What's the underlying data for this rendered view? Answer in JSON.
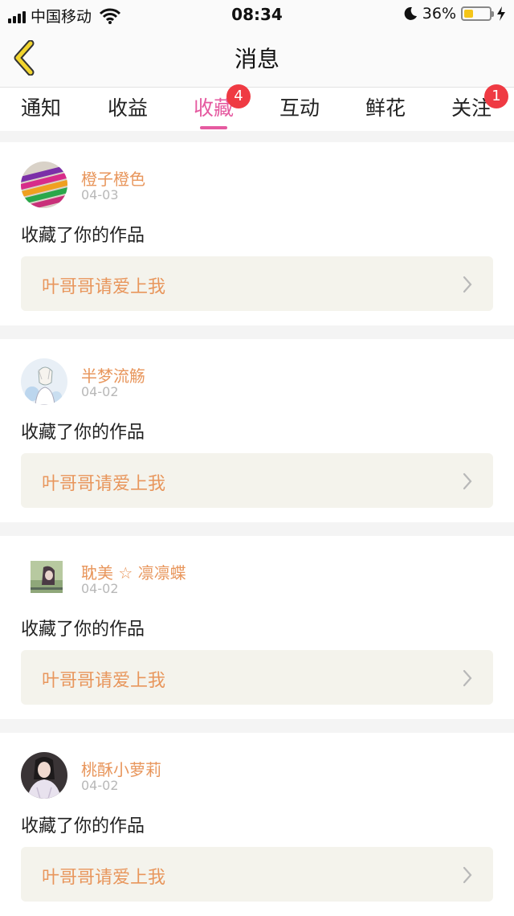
{
  "status_bar": {
    "carrier": "中国移动",
    "time": "08:34",
    "battery_percent": "36%",
    "battery_level": 0.36
  },
  "nav": {
    "title": "消息"
  },
  "tabs": [
    {
      "label": "通知"
    },
    {
      "label": "收益"
    },
    {
      "label": "收藏",
      "active": true,
      "badge": "4"
    },
    {
      "label": "互动"
    },
    {
      "label": "鲜花"
    },
    {
      "label": "关注",
      "badge": "1"
    }
  ],
  "messages": [
    {
      "username": "橙子橙色",
      "date": "04-03",
      "action": "收藏了你的作品",
      "work_title": "叶哥哥请爱上我"
    },
    {
      "username": "半梦流觞",
      "date": "04-02",
      "action": "收藏了你的作品",
      "work_title": "叶哥哥请爱上我"
    },
    {
      "username": "耽美 ☆ 凛凛蝶",
      "date": "04-02",
      "action": "收藏了你的作品",
      "work_title": "叶哥哥请爱上我"
    },
    {
      "username": "桃酥小萝莉",
      "date": "04-02",
      "action": "收藏了你的作品",
      "work_title": "叶哥哥请爱上我"
    }
  ],
  "colors": {
    "accent_pink": "#e55aa0",
    "username_orange": "#e8965c",
    "badge_red": "#ef3a43",
    "back_arrow_yellow": "#f2d52e"
  }
}
